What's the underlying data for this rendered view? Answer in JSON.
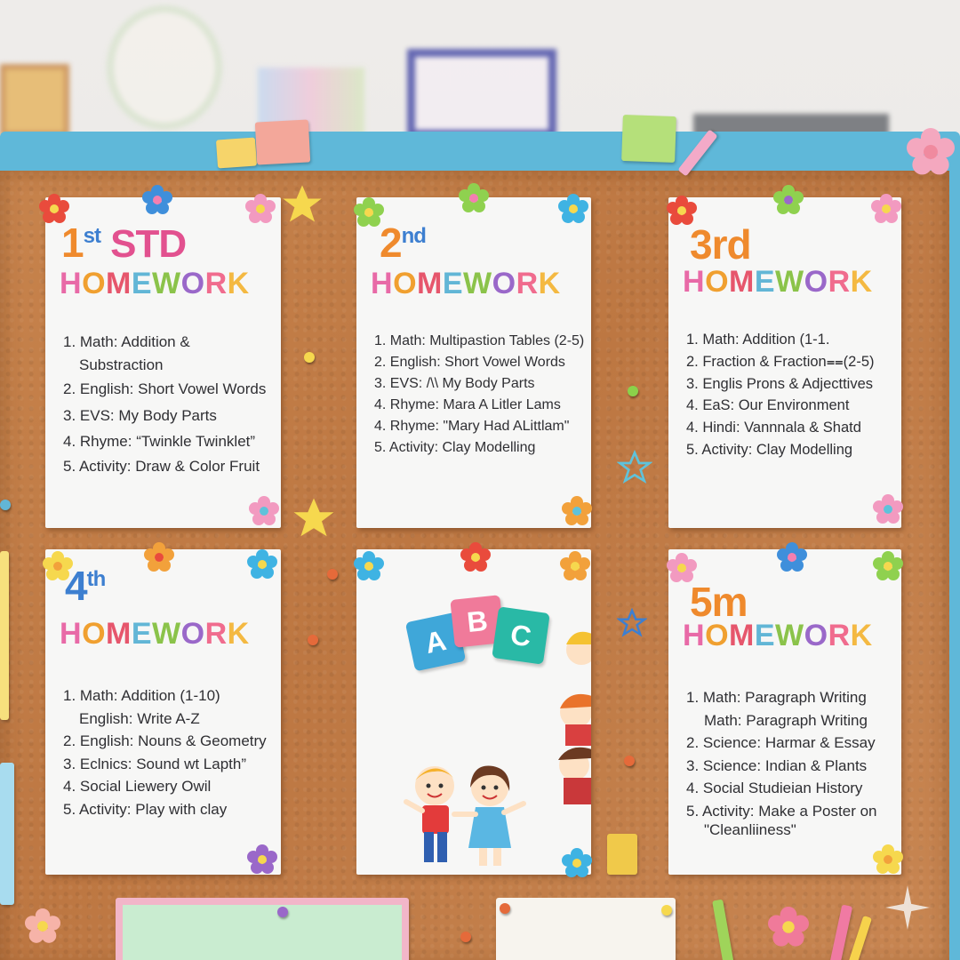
{
  "board": {
    "cards": [
      {
        "id": "std1",
        "title_num": "1",
        "title_sup": "st",
        "title_word": "STD",
        "heading": "HOMEWORK",
        "items": [
          "1. Math: Addition &",
          "Substraction",
          "2. English: Short Vowel Words",
          "3. EVS: My Body Parts",
          "4. Rhyme: “Twinkle Twinklet”",
          "5. Activity: Draw & Color Fruit"
        ]
      },
      {
        "id": "std2",
        "title_num": "2",
        "title_sup": "nd",
        "heading": "HOMEWORK",
        "items": [
          "1. Math: Multipastion Tables (2-5)",
          "2. English: Short Vowel Words",
          "3. EVS: /\\\\ My Body Parts",
          "4. Rhyme: Mara A Litler Lams",
          "4. Rhyme: \"Mary Had ALittlam\"",
          "5. Activity: Clay Modelling"
        ]
      },
      {
        "id": "std3",
        "title_num": "3rd",
        "heading": "HOMEWORK",
        "items": [
          "1. Math: Addition (1-1.",
          "2. Fraction & Fraction⩵(2-5)",
          "3. Englis Prons & Adjecttives",
          "4. EaS: Our Environment",
          "4. Hindi: Vannnala & Shatd",
          "5. Activity: Clay Modelling"
        ]
      },
      {
        "id": "std4",
        "title_num": "4",
        "title_sup": "th",
        "heading": "HOMEWORK",
        "items": [
          "1. Math: Addition (1-10)",
          "English: Write A-Z",
          "2. English: Nouns & Geometry",
          "3. Eclnics: Sound wt Lapth”",
          "4. Social Liewery Owil",
          "5. Activity: Play with clay"
        ]
      },
      {
        "id": "std5",
        "title_num": "5m",
        "heading": "HOMEWORK",
        "items": [
          "1. Math: Paragraph Writing",
          "Math: Paragraph Writing",
          "2. Science: Harmar & Essay",
          "3. Science: Indian & Plants",
          "4. Social Studieian History",
          "5. Activity: Make a Poster on",
          "\"Cleanliiness\""
        ]
      }
    ],
    "abc_blocks": [
      "A",
      "B",
      "C"
    ]
  },
  "colors": {
    "frame": "#5fb8d9",
    "cork": "#c17b45",
    "card": "#f7f7f6",
    "title_orange": "#ef8a2d",
    "title_blue": "#3d7fd0",
    "title_pink": "#e2518f",
    "text": "#2f2f33"
  },
  "icons": [
    "flower-pin",
    "star-sticker",
    "push-pin",
    "abc-blocks",
    "kids-illustration",
    "pencil-cup"
  ]
}
